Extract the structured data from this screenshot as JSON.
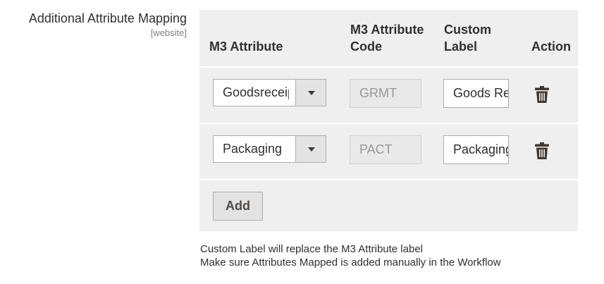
{
  "field": {
    "title": "Additional Attribute Mapping",
    "scope": "[website]"
  },
  "grid": {
    "headers": {
      "attribute": "M3 Attribute",
      "code_line1": "M3 Attribute",
      "code_line2": "Code",
      "label_line1": "Custom",
      "label_line2": "Label",
      "action": "Action"
    },
    "rows": [
      {
        "attribute": "Goodsreceipt",
        "code": "GRMT",
        "label": "Goods Receipt"
      },
      {
        "attribute": "Packaging",
        "code": "PACT",
        "label": "Packaging"
      }
    ],
    "add_label": "Add",
    "action_icon": "trash-icon"
  },
  "notes": [
    "Custom Label will replace the M3 Attribute label",
    "Make sure Attributes Mapped is added manually in the Workflow"
  ],
  "colors": {
    "panel_bg": "#efefef",
    "button_bg": "#e3e3e3",
    "icon": "#41362f"
  }
}
